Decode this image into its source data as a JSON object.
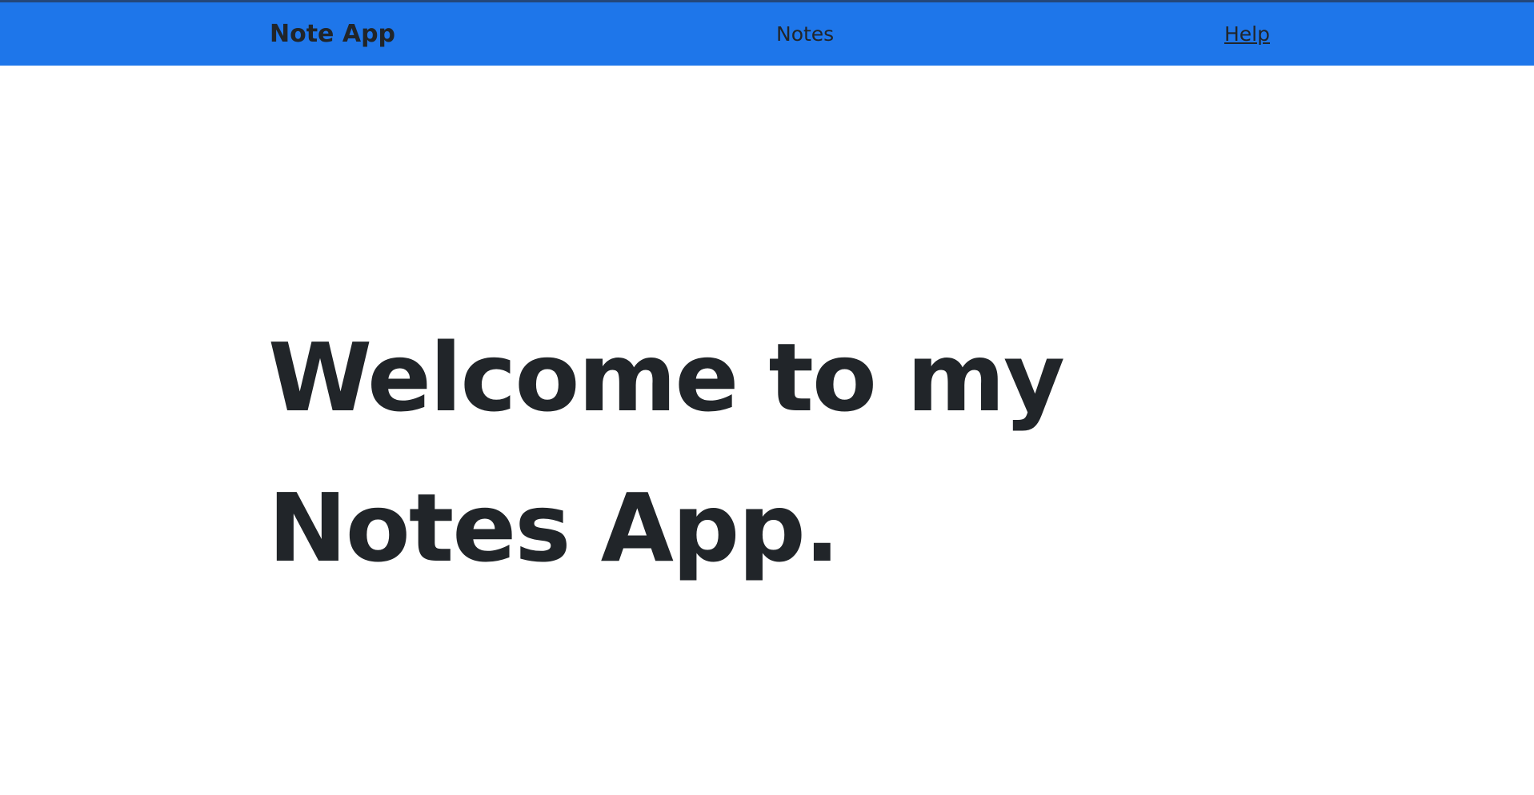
{
  "navbar": {
    "brand": "Note App",
    "links": [
      {
        "label": "Notes"
      },
      {
        "label": "Help"
      }
    ],
    "background_color": "#1e76ea"
  },
  "hero": {
    "heading": "Welcome to my Notes App."
  }
}
